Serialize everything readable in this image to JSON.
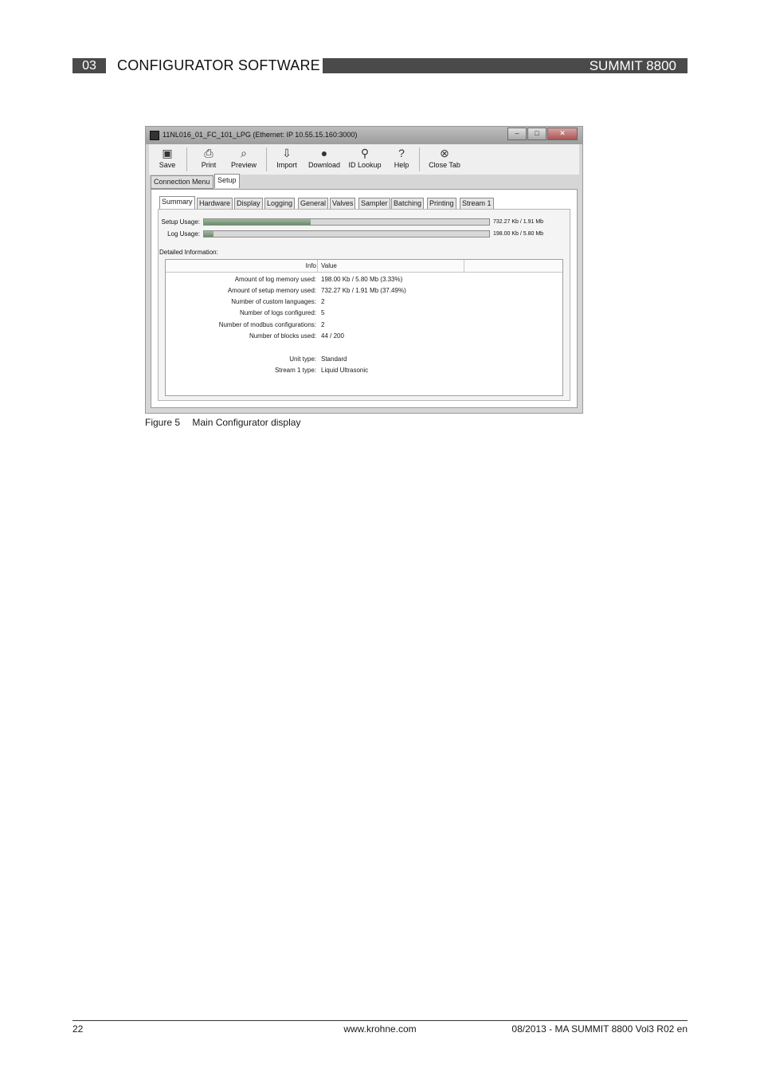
{
  "header": {
    "section_number": "03",
    "section_title": "CONFIGURATOR SOFTWARE",
    "product": "SUMMIT 8800"
  },
  "window": {
    "title": "11NL016_01_FC_101_LPG (Ethernet: IP 10.55.15.160:3000)",
    "controls": [
      "–",
      "□",
      "✕"
    ],
    "toolbar": [
      {
        "label": "Save",
        "icon": "floppy-icon"
      },
      {
        "label": "Print",
        "icon": "printer-icon"
      },
      {
        "label": "Preview",
        "icon": "preview-icon"
      },
      {
        "label": "Import",
        "icon": "import-icon"
      },
      {
        "label": "Download",
        "icon": "download-icon"
      },
      {
        "label": "ID Lookup",
        "icon": "magnifier-icon"
      },
      {
        "label": "Help",
        "icon": "help-icon"
      },
      {
        "label": "Close Tab",
        "icon": "close-circle-icon"
      }
    ],
    "app_tabs": [
      "Connection Menu",
      "Setup"
    ],
    "sub_tabs": [
      "Summary",
      "Hardware",
      "Display",
      "Logging",
      "General",
      "Valves",
      "Sampler",
      "Batching",
      "Printing",
      "Stream 1"
    ],
    "usage": {
      "setup_label": "Setup Usage:",
      "setup_value": "732.27 Kb / 1.91 Mb",
      "setup_fraction": 0.3749,
      "log_label": "Log Usage:",
      "log_value": "198.00 Kb / 5.80 Mb",
      "log_fraction": 0.0333
    },
    "detail_label": "Detailed Information:",
    "info_headers": {
      "key": "Info",
      "value": "Value"
    },
    "info_rows": [
      {
        "key": "Amount of log memory used:",
        "value": "198.00 Kb / 5.80 Mb (3.33%)"
      },
      {
        "key": "Amount of setup memory used:",
        "value": "732.27 Kb / 1.91 Mb (37.49%)"
      },
      {
        "key": "Number of custom languages:",
        "value": "2"
      },
      {
        "key": "Number of logs configured:",
        "value": "5"
      },
      {
        "key": "Number of modbus configurations:",
        "value": "2"
      },
      {
        "key": "Number of blocks used:",
        "value": "44 / 200"
      },
      {
        "key": "",
        "value": ""
      },
      {
        "key": "Unit type:",
        "value": "Standard"
      },
      {
        "key": "Stream 1 type:",
        "value": "Liquid Ultrasonic"
      }
    ]
  },
  "caption": {
    "figure": "Figure 5",
    "text": "Main Configurator display"
  },
  "footer": {
    "page": "22",
    "url": "www.krohne.com",
    "doc": "08/2013 - MA SUMMIT 8800 Vol3 R02 en"
  }
}
